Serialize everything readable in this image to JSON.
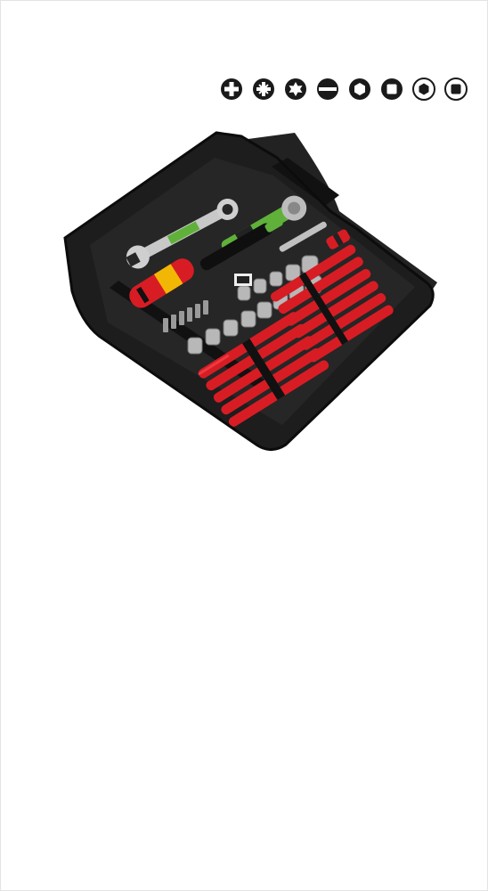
{
  "product": {
    "image_name": "tool-kit-image"
  },
  "drive_icons": [
    {
      "name": "phillips-icon"
    },
    {
      "name": "pozidriv-icon"
    },
    {
      "name": "torx-icon"
    },
    {
      "name": "slotted-icon"
    },
    {
      "name": "hex-icon"
    },
    {
      "name": "square-icon"
    },
    {
      "name": "hex-socket-icon"
    },
    {
      "name": "square-socket-icon"
    }
  ],
  "colors": {
    "icon": "#1a1a1a",
    "pouch": "#1d1d1d",
    "accent_red": "#d81c24",
    "accent_green": "#5fb13a",
    "border": "#e3e3e3"
  }
}
